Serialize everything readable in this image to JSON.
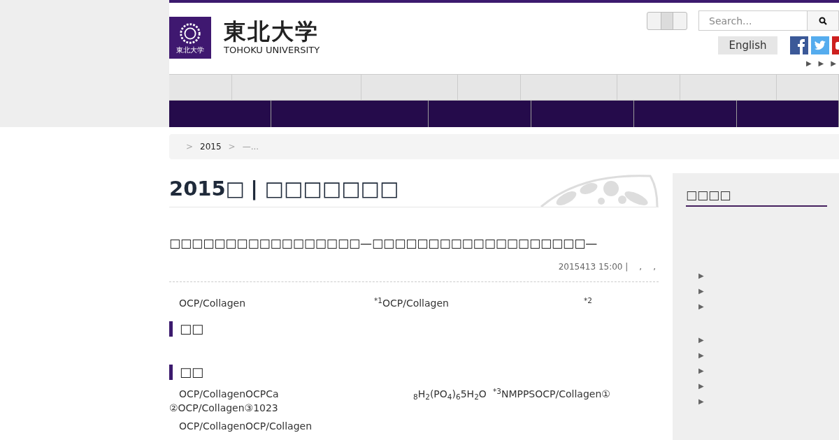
{
  "header": {
    "logo_mark_text": "東北大学",
    "logo_title": "東北大学",
    "logo_subtitle": "TOHOKU UNIVERSITY",
    "search": {
      "placeholder": "Search..."
    },
    "language_button": "English",
    "display_switch": {
      "on": false
    },
    "small_links": [
      "▶",
      "▶",
      "▶"
    ]
  },
  "breadcrumb": [
    {
      "separator": ">",
      "label": "2015"
    },
    {
      "separator": ">",
      "label": "—..."
    }
  ],
  "page_heading": {
    "year": "2015□",
    "rest": "| □□□□□□□"
  },
  "article": {
    "title": "□□□□□□□□□□□□□□□□□—□□□□□□□□□□□□□□□□□□□—",
    "meta": [
      "2015413 15:00 |",
      ",",
      ","
    ],
    "blocks": [
      {
        "kind": "paragraph",
        "lines": [
          [
            "OCP/Collagen",
            "$^{*1}$OCP/Collagen",
            "$^{*2}$"
          ]
        ]
      },
      {
        "kind": "heading",
        "text": "□□"
      },
      {
        "kind": "spacer"
      },
      {
        "kind": "heading",
        "text": "□□"
      },
      {
        "kind": "paragraph",
        "lines": [
          [
            "OCP/CollagenOCPCa",
            "$_{8}$H$_{2}$(PO$_{4}$)$_{6}$5H$_{2}$O",
            "$^{*3}$NMPPSOCP/Collagen①"
          ],
          [
            "②OCP/Collagen③1023"
          ]
        ]
      },
      {
        "kind": "paragraph",
        "lines": [
          [
            "OCP/CollagenOCP/Collagen"
          ]
        ]
      }
    ]
  },
  "sidebar": {
    "title": "□□□□",
    "groups": [
      [
        "▶",
        "▶",
        "▶"
      ],
      [
        "▶",
        "▶",
        "▶",
        "▶",
        "▶"
      ]
    ]
  }
}
